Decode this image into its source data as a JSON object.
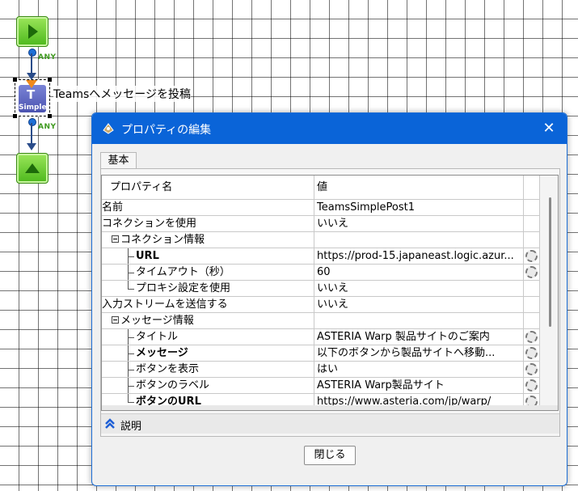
{
  "canvas": {
    "node_label": "Teamsへメッセージを投稿",
    "connection_label_1": "ANY",
    "connection_label_2": "ANY",
    "component_badge": "Simple"
  },
  "dialog": {
    "title": "プロパティの編集",
    "tab_label": "基本",
    "header": {
      "name": "プロパティ名",
      "value": "値"
    },
    "rows": [
      {
        "name": "名前",
        "value": "TeamsSimplePost1",
        "bold": false,
        "level": 0
      },
      {
        "name": "コネクションを使用",
        "value": "いいえ",
        "bold": false,
        "level": 0
      },
      {
        "name": "コネクション情報",
        "value": "",
        "bold": false,
        "level": 1,
        "group": true
      },
      {
        "name": "URL",
        "value": "https://prod-15.japaneast.logic.azur...",
        "bold": true,
        "level": 2,
        "button": true
      },
      {
        "name": "タイムアウト（秒）",
        "value": "60",
        "bold": false,
        "level": 2,
        "button": true
      },
      {
        "name": "プロキシ設定を使用",
        "value": "いいえ",
        "bold": false,
        "level": 2,
        "last": true
      },
      {
        "name": "入力ストリームを送信する",
        "value": "いいえ",
        "bold": false,
        "level": 0
      },
      {
        "name": "メッセージ情報",
        "value": "",
        "bold": false,
        "level": 1,
        "group": true
      },
      {
        "name": "タイトル",
        "value": "ASTERIA Warp 製品サイトのご案内",
        "bold": false,
        "level": 2,
        "button": true
      },
      {
        "name": "メッセージ",
        "value": "以下のボタンから製品サイトへ移動...",
        "bold": true,
        "level": 2,
        "button": true
      },
      {
        "name": "ボタンを表示",
        "value": "はい",
        "bold": false,
        "level": 2,
        "button": true
      },
      {
        "name": "ボタンのラベル",
        "value": "ASTERIA Warp製品サイト",
        "bold": false,
        "level": 2,
        "button": true
      },
      {
        "name": "ボタンのURL",
        "value": "https://www.asteria.com/jp/warp/",
        "bold": true,
        "level": 2,
        "button": true,
        "last": true
      }
    ],
    "description_label": "説明",
    "close_button": "閉じる",
    "accent_color": "#0a64d8"
  }
}
